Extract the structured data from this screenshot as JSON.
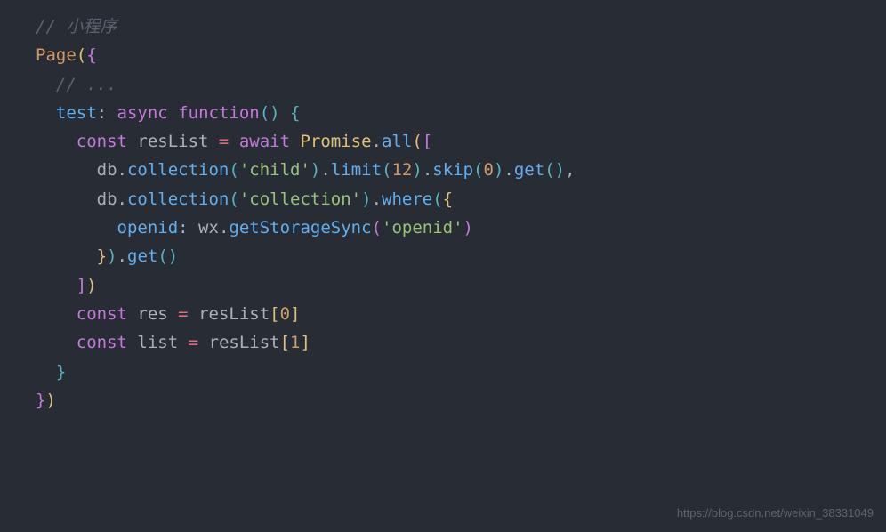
{
  "code": {
    "line1_comment": "// 小程序",
    "line2_page": "Page",
    "line2_paren_open": "(",
    "line2_brace_open": "{",
    "line3_comment": "// ...",
    "line4_test": "test",
    "line4_colon": ": ",
    "line4_async": "async",
    "line4_function": "function",
    "line4_parens": "()",
    "line4_brace": " {",
    "line5_const": "const",
    "line5_reslist": " resList ",
    "line5_equals": "=",
    "line5_await": " await ",
    "line5_promise": "Promise",
    "line5_dot": ".",
    "line5_all": "all",
    "line5_paren_open": "(",
    "line5_bracket_open": "[",
    "line6_db": "db",
    "line6_dot1": ".",
    "line6_collection": "collection",
    "line6_paren1_open": "(",
    "line6_str_child": "'child'",
    "line6_paren1_close": ")",
    "line6_dot2": ".",
    "line6_limit": "limit",
    "line6_paren2_open": "(",
    "line6_num_12": "12",
    "line6_paren2_close": ")",
    "line6_dot3": ".",
    "line6_skip": "skip",
    "line6_paren3_open": "(",
    "line6_num_0": "0",
    "line6_paren3_close": ")",
    "line6_dot4": ".",
    "line6_get": "get",
    "line6_paren4_open": "(",
    "line6_paren4_close": ")",
    "line6_comma": ",",
    "line7_db": "db",
    "line7_dot1": ".",
    "line7_collection": "collection",
    "line7_paren1_open": "(",
    "line7_str_collection": "'collection'",
    "line7_paren1_close": ")",
    "line7_dot2": ".",
    "line7_where": "where",
    "line7_paren2_open": "(",
    "line7_brace_open": "{",
    "line8_openid": "openid",
    "line8_colon": ": ",
    "line8_wx": "wx",
    "line8_dot": ".",
    "line8_getstoragesync": "getStorageSync",
    "line8_paren_open": "(",
    "line8_str_openid": "'openid'",
    "line8_paren_close": ")",
    "line9_brace_close": "}",
    "line9_paren_close": ")",
    "line9_dot": ".",
    "line9_get": "get",
    "line9_paren2_open": "(",
    "line9_paren2_close": ")",
    "line10_bracket_close": "]",
    "line10_paren_close": ")",
    "line11_const": "const",
    "line11_res": " res ",
    "line11_equals": "=",
    "line11_reslist": " resList",
    "line11_bracket_open": "[",
    "line11_num_0": "0",
    "line11_bracket_close": "]",
    "line12_const": "const",
    "line12_list": " list ",
    "line12_equals": "=",
    "line12_reslist": " resList",
    "line12_bracket_open": "[",
    "line12_num_1": "1",
    "line12_bracket_close": "]",
    "line13_brace": "}",
    "line14_brace": "}",
    "line14_paren": ")"
  },
  "watermark": "https://blog.csdn.net/weixin_38331049"
}
